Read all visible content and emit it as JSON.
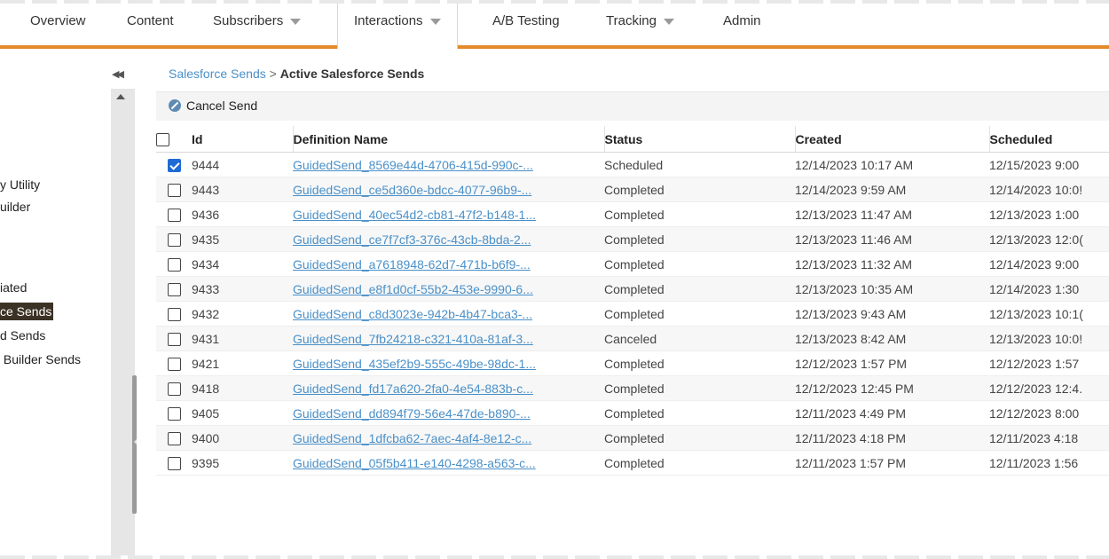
{
  "nav": {
    "items": [
      {
        "label": "Overview",
        "dropdown": false,
        "active": false
      },
      {
        "label": "Content",
        "dropdown": false,
        "active": false
      },
      {
        "label": "Subscribers",
        "dropdown": true,
        "active": false
      },
      {
        "label": "Interactions",
        "dropdown": true,
        "active": true
      },
      {
        "label": "A/B Testing",
        "dropdown": false,
        "active": false
      },
      {
        "label": "Tracking",
        "dropdown": true,
        "active": false
      },
      {
        "label": "Admin",
        "dropdown": false,
        "active": false
      }
    ],
    "accent_color": "#e38a2b"
  },
  "sidebar": {
    "collapse_icon": "double-chevron-left-icon",
    "items": [
      {
        "label": "y Utility",
        "selected": false
      },
      {
        "label": "uilder",
        "selected": false
      },
      {
        "label": "iated",
        "selected": false
      },
      {
        "label": "ce Sends",
        "selected": true
      },
      {
        "label": "d Sends",
        "selected": false
      },
      {
        "label": " Builder Sends",
        "selected": false
      }
    ]
  },
  "breadcrumb": {
    "parent": "Salesforce Sends",
    "separator": " > ",
    "current": "Active Salesforce Sends"
  },
  "toolbar": {
    "cancel_label": "Cancel Send",
    "cancel_icon": "cancel-circle-icon"
  },
  "table": {
    "columns": [
      "Id",
      "Definition Name",
      "Status",
      "Created",
      "Scheduled"
    ],
    "rows": [
      {
        "checked": true,
        "id": "9444",
        "name": "GuidedSend_8569e44d-4706-415d-990c-...",
        "status": "Scheduled",
        "created": "12/14/2023 10:17 AM",
        "scheduled": "12/15/2023 9:00"
      },
      {
        "checked": false,
        "id": "9443",
        "name": "GuidedSend_ce5d360e-bdcc-4077-96b9-...",
        "status": "Completed",
        "created": "12/14/2023 9:59 AM",
        "scheduled": "12/14/2023 10:0!"
      },
      {
        "checked": false,
        "id": "9436",
        "name": "GuidedSend_40ec54d2-cb81-47f2-b148-1...",
        "status": "Completed",
        "created": "12/13/2023 11:47 AM",
        "scheduled": "12/13/2023 1:00"
      },
      {
        "checked": false,
        "id": "9435",
        "name": "GuidedSend_ce7f7cf3-376c-43cb-8bda-2...",
        "status": "Completed",
        "created": "12/13/2023 11:46 AM",
        "scheduled": "12/13/2023 12:0("
      },
      {
        "checked": false,
        "id": "9434",
        "name": "GuidedSend_a7618948-62d7-471b-b6f9-...",
        "status": "Completed",
        "created": "12/13/2023 11:32 AM",
        "scheduled": "12/14/2023 9:00"
      },
      {
        "checked": false,
        "id": "9433",
        "name": "GuidedSend_e8f1d0cf-55b2-453e-9990-6...",
        "status": "Completed",
        "created": "12/13/2023 10:35 AM",
        "scheduled": "12/14/2023 1:30"
      },
      {
        "checked": false,
        "id": "9432",
        "name": "GuidedSend_c8d3023e-942b-4b47-bca3-...",
        "status": "Completed",
        "created": "12/13/2023 9:43 AM",
        "scheduled": "12/13/2023 10:1("
      },
      {
        "checked": false,
        "id": "9431",
        "name": "GuidedSend_7fb24218-c321-410a-81af-3...",
        "status": "Canceled",
        "created": "12/13/2023 8:42 AM",
        "scheduled": "12/13/2023 10:0!"
      },
      {
        "checked": false,
        "id": "9421",
        "name": "GuidedSend_435ef2b9-555c-49be-98dc-1...",
        "status": "Completed",
        "created": "12/12/2023 1:57 PM",
        "scheduled": "12/12/2023 1:57"
      },
      {
        "checked": false,
        "id": "9418",
        "name": "GuidedSend_fd17a620-2fa0-4e54-883b-c...",
        "status": "Completed",
        "created": "12/12/2023 12:45 PM",
        "scheduled": "12/12/2023 12:4."
      },
      {
        "checked": false,
        "id": "9405",
        "name": "GuidedSend_dd894f79-56e4-47de-b890-...",
        "status": "Completed",
        "created": "12/11/2023 4:49 PM",
        "scheduled": "12/12/2023 8:00"
      },
      {
        "checked": false,
        "id": "9400",
        "name": "GuidedSend_1dfcba62-7aec-4af4-8e12-c...",
        "status": "Completed",
        "created": "12/11/2023 4:18 PM",
        "scheduled": "12/11/2023 4:18"
      },
      {
        "checked": false,
        "id": "9395",
        "name": "GuidedSend_05f5b411-e140-4298-a563-c...",
        "status": "Completed",
        "created": "12/11/2023 1:57 PM",
        "scheduled": "12/11/2023 1:56"
      }
    ]
  }
}
